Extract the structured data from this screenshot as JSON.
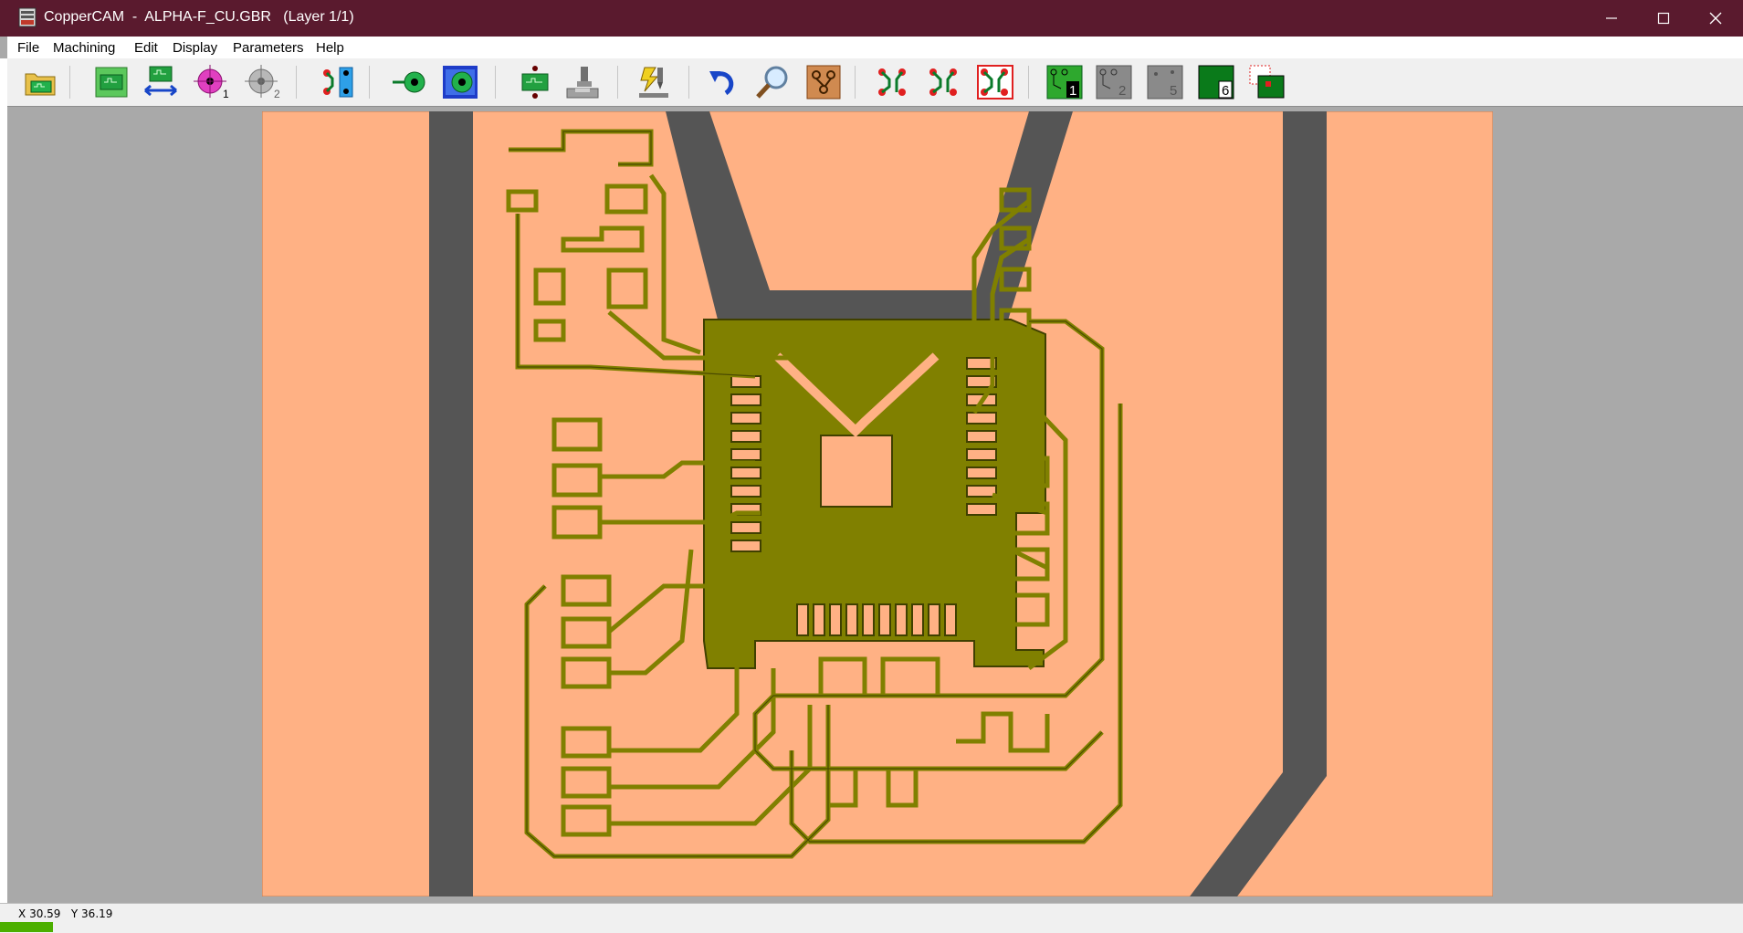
{
  "window": {
    "title": "CopperCAM  -  ALPHA-F_CU.GBR   (Layer 1/1)"
  },
  "menu": {
    "items": [
      "File",
      "Machining",
      "Edit",
      "Display",
      "Parameters",
      "Help"
    ]
  },
  "toolbar": {
    "buttons": [
      "open-file-icon",
      "board-contour-icon",
      "flip-board-icon",
      "drill-layer-1-icon",
      "drill-layer-2-icon",
      "track-select-icon",
      "pad-select-icon",
      "pad-ring-icon",
      "component-icon",
      "tool-spindle-icon",
      "run-machining-icon",
      "undo-icon",
      "zoom-icon",
      "board-view-icon",
      "contour-1-icon",
      "contour-2-icon",
      "contour-3-icon",
      "layer-1-icon",
      "layer-2-icon",
      "layer-5-icon",
      "layer-6-icon",
      "layers-overlay-icon"
    ],
    "layer_numbers": [
      "1",
      "2",
      "5",
      "6"
    ]
  },
  "status": {
    "x_label": "X",
    "x_value": "30.59",
    "y_label": "Y",
    "y_value": "36.19"
  },
  "colors": {
    "titlebar": "#5a1a2e",
    "board": "#ffb184",
    "copper": "#808000",
    "cut": "#555555",
    "workspace": "#a9a9a9"
  }
}
